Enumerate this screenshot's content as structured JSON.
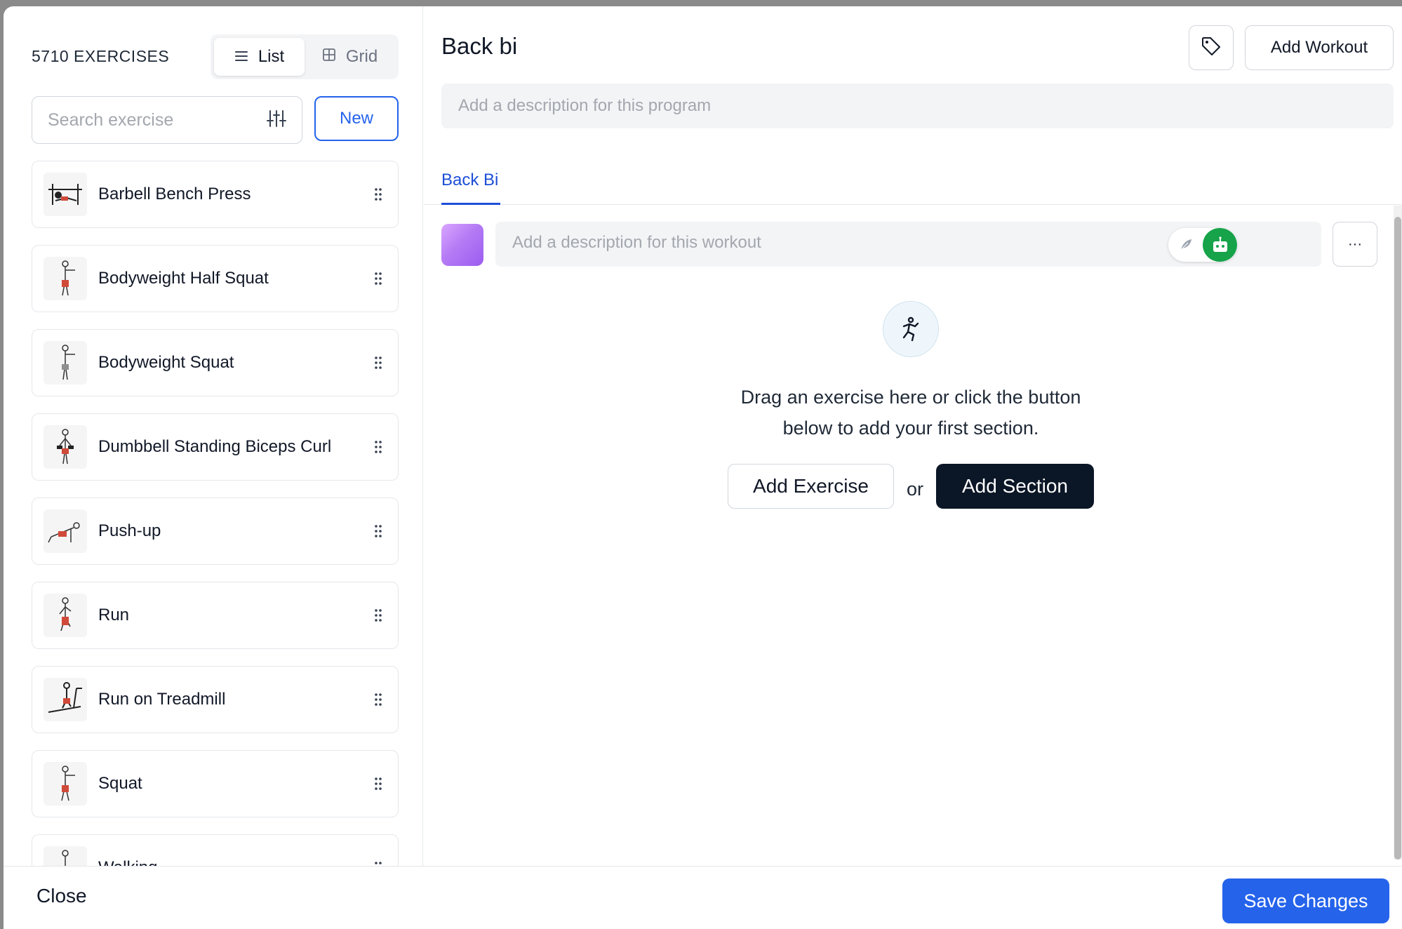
{
  "library": {
    "count_label": "5710 EXERCISES",
    "view_toggle": {
      "list_label": "List",
      "grid_label": "Grid",
      "active": "list"
    },
    "search": {
      "placeholder": "Search exercise",
      "value": ""
    },
    "new_label": "New",
    "exercises": [
      {
        "name": "Barbell Bench Press"
      },
      {
        "name": "Bodyweight Half Squat"
      },
      {
        "name": "Bodyweight Squat"
      },
      {
        "name": "Dumbbell Standing Biceps Curl"
      },
      {
        "name": "Push-up"
      },
      {
        "name": "Run"
      },
      {
        "name": "Run on Treadmill"
      },
      {
        "name": "Squat"
      },
      {
        "name": "Walking"
      }
    ]
  },
  "program": {
    "title": "Back bi",
    "tag_icon": "tag-icon",
    "add_workout_label": "Add Workout",
    "description_placeholder": "Add a description for this program",
    "tabs": [
      {
        "label": "Back Bi",
        "active": true
      }
    ],
    "workout": {
      "description_placeholder": "Add a description for this workout",
      "more_label": "···"
    },
    "empty_state": {
      "line1": "Drag an exercise here or click the button",
      "line2": "below to add your first section.",
      "add_exercise_label": "Add Exercise",
      "or_label": "or",
      "add_section_label": "Add Section"
    }
  },
  "footer": {
    "close_label": "Close",
    "save_label": "Save Changes"
  },
  "colors": {
    "accent": "#2563eb",
    "dark_button": "#0b1626",
    "ai_green": "#16a34a"
  }
}
